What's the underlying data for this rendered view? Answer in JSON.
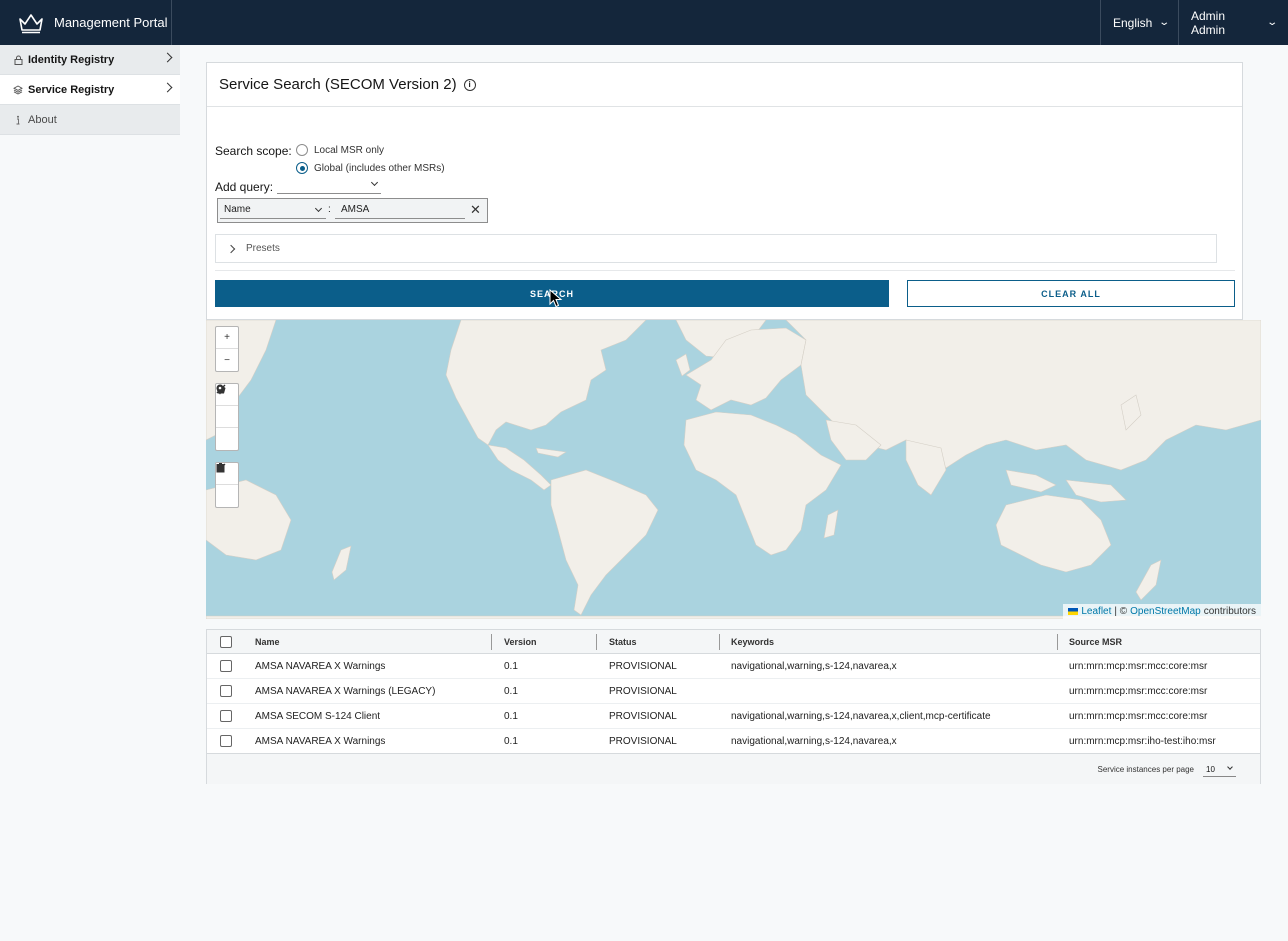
{
  "header": {
    "app_title": "Management Portal",
    "language": "English",
    "user": "Admin Admin"
  },
  "sidebar": {
    "items": [
      {
        "label": "Identity Registry",
        "icon": "lock-icon"
      },
      {
        "label": "Service Registry",
        "icon": "layers-icon"
      },
      {
        "label": "About",
        "icon": "info-icon"
      }
    ]
  },
  "search": {
    "title": "Service Search (SECOM Version 2)",
    "scope_label": "Search scope:",
    "scope_options": [
      "Local MSR only",
      "Global (includes other MSRs)"
    ],
    "scope_selected": "Global (includes other MSRs)",
    "add_query_label": "Add query:",
    "add_query_value": "",
    "query_field": "Name",
    "query_separator": ":",
    "query_value": "AMSA",
    "presets_label": "Presets",
    "search_button": "SEARCH",
    "clear_button": "CLEAR ALL"
  },
  "map": {
    "zoom_in": "+",
    "zoom_out": "−",
    "attribution_leaflet": "Leaflet",
    "attribution_sep": "| ©",
    "attribution_osm": "OpenStreetMap",
    "attribution_tail": "contributors",
    "colors": {
      "water": "#aad3df",
      "land": "#f2efe9"
    }
  },
  "table": {
    "columns": [
      "Name",
      "Version",
      "Status",
      "Keywords",
      "Source MSR"
    ],
    "rows": [
      {
        "name": "AMSA NAVAREA X Warnings",
        "version": "0.1",
        "status": "PROVISIONAL",
        "keywords": "navigational,warning,s-124,navarea,x",
        "source": "urn:mrn:mcp:msr:mcc:core:msr"
      },
      {
        "name": "AMSA NAVAREA X Warnings (LEGACY)",
        "version": "0.1",
        "status": "PROVISIONAL",
        "keywords": "",
        "source": "urn:mrn:mcp:msr:mcc:core:msr"
      },
      {
        "name": "AMSA SECOM S-124 Client",
        "version": "0.1",
        "status": "PROVISIONAL",
        "keywords": "navigational,warning,s-124,navarea,x,client,mcp-certificate",
        "source": "urn:mrn:mcp:msr:mcc:core:msr"
      },
      {
        "name": "AMSA NAVAREA X Warnings",
        "version": "0.1",
        "status": "PROVISIONAL",
        "keywords": "navigational,warning,s-124,navarea,x",
        "source": "urn:mrn:mcp:msr:iho-test:iho:msr"
      }
    ],
    "per_page_label": "Service instances per page",
    "per_page_value": "10"
  }
}
